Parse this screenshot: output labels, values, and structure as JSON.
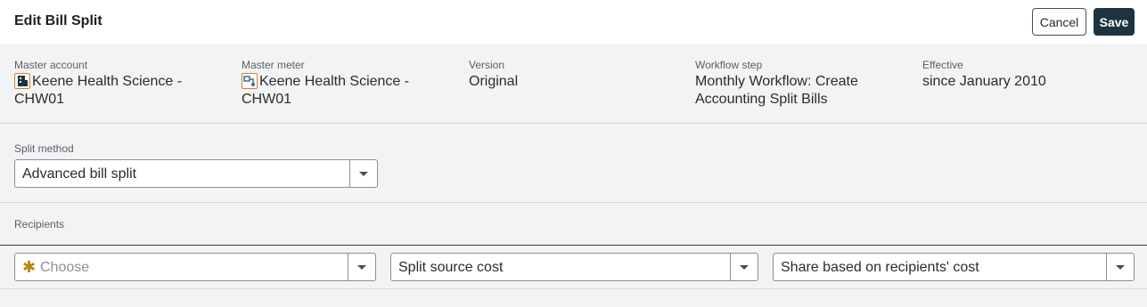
{
  "header": {
    "title": "Edit Bill Split",
    "cancel_label": "Cancel",
    "save_label": "Save"
  },
  "info": {
    "master_account": {
      "label": "Master account",
      "value_line1": "Keene Health Science -",
      "value_line2": "CHW01",
      "icon": "account-icon"
    },
    "master_meter": {
      "label": "Master meter",
      "value_line1": "Keene Health Science -",
      "value_line2": "CHW01",
      "icon": "meter-icon"
    },
    "version": {
      "label": "Version",
      "value": "Original"
    },
    "workflow_step": {
      "label": "Workflow step",
      "value_line1": "Monthly Workflow: Create",
      "value_line2": "Accounting Split Bills"
    },
    "effective": {
      "label": "Effective",
      "value": "since January 2010"
    }
  },
  "split_method": {
    "label": "Split method",
    "selected": "Advanced bill split"
  },
  "recipients": {
    "label": "Recipients",
    "row": {
      "recipient_placeholder": "Choose",
      "cost_source": "Split source cost",
      "share_basis": "Share based on recipients' cost"
    }
  },
  "colors": {
    "save_bg": "#1d3440",
    "icon_accent": "#e07a2a",
    "required_marker": "#b8860b"
  }
}
